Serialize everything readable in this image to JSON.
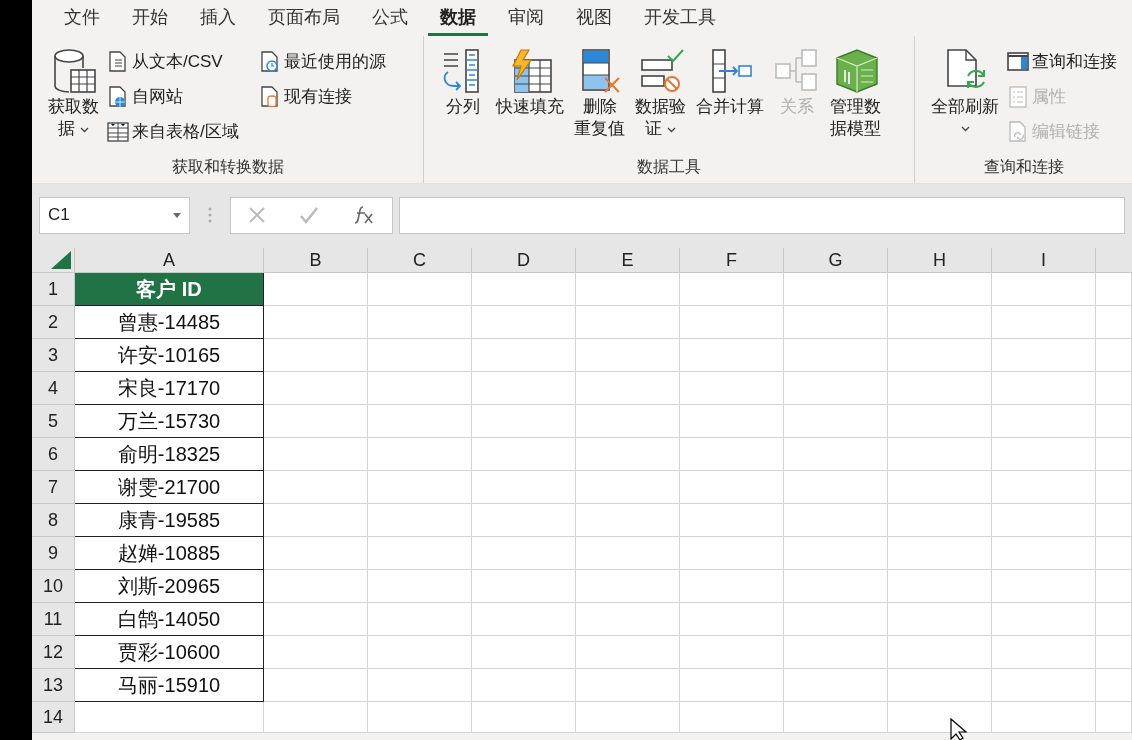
{
  "tabs": [
    {
      "label": "文件",
      "selected": false
    },
    {
      "label": "开始",
      "selected": false
    },
    {
      "label": "插入",
      "selected": false
    },
    {
      "label": "页面布局",
      "selected": false
    },
    {
      "label": "公式",
      "selected": false
    },
    {
      "label": "数据",
      "selected": true
    },
    {
      "label": "审阅",
      "selected": false
    },
    {
      "label": "视图",
      "selected": false
    },
    {
      "label": "开发工具",
      "selected": false
    }
  ],
  "ribbon_groups": [
    {
      "label": "获取和转换数据",
      "large": [
        {
          "lines": [
            "获取数",
            "据"
          ],
          "dropdown": true,
          "disabled": false
        }
      ],
      "small_columns": [
        [
          {
            "label": "从文本/CSV",
            "disabled": false
          },
          {
            "label": "自网站",
            "disabled": false
          },
          {
            "label": "来自表格/区域",
            "disabled": false
          }
        ],
        [
          {
            "label": "最近使用的源",
            "disabled": false
          },
          {
            "label": "现有连接",
            "disabled": false
          }
        ]
      ]
    },
    {
      "label": "数据工具",
      "large": [
        {
          "lines": [
            "分列"
          ],
          "dropdown": false,
          "disabled": false
        },
        {
          "lines": [
            "快速填充"
          ],
          "dropdown": false,
          "disabled": false
        },
        {
          "lines": [
            "删除",
            "重复值"
          ],
          "dropdown": false,
          "disabled": false
        },
        {
          "lines": [
            "数据验",
            "证"
          ],
          "dropdown": true,
          "disabled": false
        },
        {
          "lines": [
            "合并计算"
          ],
          "dropdown": false,
          "disabled": false
        },
        {
          "lines": [
            "关系"
          ],
          "dropdown": false,
          "disabled": true
        },
        {
          "lines": [
            "管理数",
            "据模型"
          ],
          "dropdown": false,
          "disabled": false
        }
      ]
    },
    {
      "label": "查询和连接",
      "large": [
        {
          "lines": [
            "全部刷新"
          ],
          "dropdown": true,
          "disabled": false
        }
      ],
      "small_columns": [
        [
          {
            "label": "查询和连接",
            "disabled": false
          },
          {
            "label": "属性",
            "disabled": true
          },
          {
            "label": "编辑链接",
            "disabled": true
          }
        ]
      ]
    }
  ],
  "name_box": "C1",
  "sheet": {
    "columns": [
      "A",
      "B",
      "C",
      "D",
      "E",
      "F",
      "G",
      "H",
      "I"
    ],
    "rows": [
      {
        "number": "1",
        "kind": "header",
        "cells": [
          "客户 ID"
        ]
      },
      {
        "number": "2",
        "kind": "data",
        "cells": [
          "曾惠-14485"
        ]
      },
      {
        "number": "3",
        "kind": "data",
        "cells": [
          "许安-10165"
        ]
      },
      {
        "number": "4",
        "kind": "data",
        "cells": [
          "宋良-17170"
        ]
      },
      {
        "number": "5",
        "kind": "data",
        "cells": [
          "万兰-15730"
        ]
      },
      {
        "number": "6",
        "kind": "data",
        "cells": [
          "俞明-18325"
        ]
      },
      {
        "number": "7",
        "kind": "data",
        "cells": [
          "谢雯-21700"
        ]
      },
      {
        "number": "8",
        "kind": "data",
        "cells": [
          "康青-19585"
        ]
      },
      {
        "number": "9",
        "kind": "data",
        "cells": [
          "赵婵-10885"
        ]
      },
      {
        "number": "10",
        "kind": "data",
        "cells": [
          "刘斯-20965"
        ]
      },
      {
        "number": "11",
        "kind": "data",
        "cells": [
          "白鹄-14050"
        ]
      },
      {
        "number": "12",
        "kind": "data",
        "cells": [
          "贾彩-10600"
        ]
      },
      {
        "number": "13",
        "kind": "data",
        "cells": [
          "马丽-15910"
        ]
      },
      {
        "number": "14",
        "cells": []
      }
    ]
  }
}
